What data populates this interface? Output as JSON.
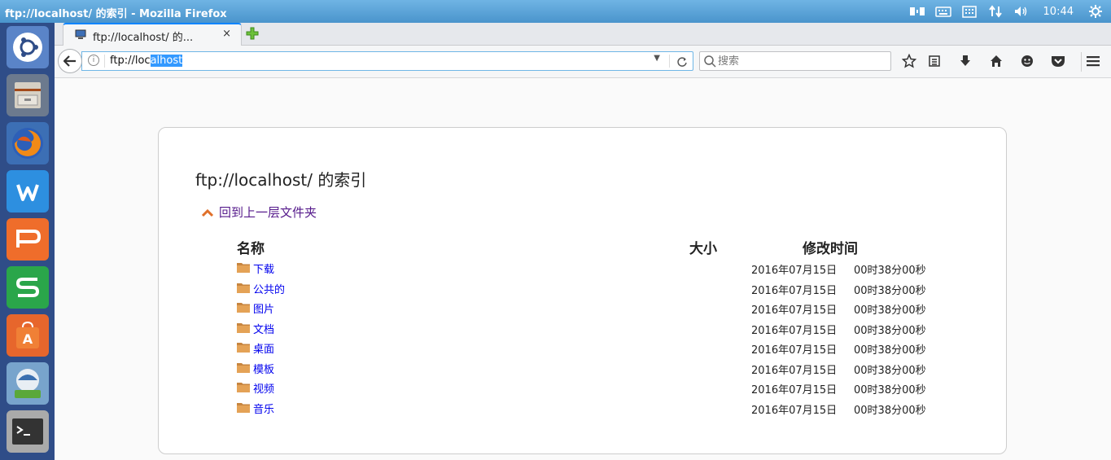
{
  "window": {
    "title": "ftp://localhost/ 的索引 - Mozilla Firefox"
  },
  "tray": {
    "icons": [
      "tiling-icon",
      "keyboard-icon",
      "keyboard-layout-icon",
      "network-icon",
      "volume-icon",
      "settings-gear-icon"
    ],
    "clock": "10:44"
  },
  "launcher": {
    "items": [
      "ubuntu-dash",
      "files",
      "firefox",
      "wps-writer",
      "wps-presentation",
      "wps-spreadsheets",
      "software-center",
      "system-tool",
      "terminal"
    ]
  },
  "tab": {
    "label": "ftp://localhost/ 的...",
    "close": "×"
  },
  "urlbar": {
    "url_plain": "ftp://loc",
    "url_selected": "alhost"
  },
  "search": {
    "placeholder": "搜索"
  },
  "page": {
    "heading": "ftp://localhost/ 的索引",
    "up_link": "回到上一层文件夹",
    "columns": {
      "name": "名称",
      "size": "大小",
      "modified": "修改时间"
    },
    "rows": [
      {
        "name": "下载",
        "date": "2016年07月15日",
        "time": "00时38分00秒"
      },
      {
        "name": "公共的",
        "date": "2016年07月15日",
        "time": "00时38分00秒"
      },
      {
        "name": "图片",
        "date": "2016年07月15日",
        "time": "00时38分00秒"
      },
      {
        "name": "文档",
        "date": "2016年07月15日",
        "time": "00时38分00秒"
      },
      {
        "name": "桌面",
        "date": "2016年07月15日",
        "time": "00时38分00秒"
      },
      {
        "name": "模板",
        "date": "2016年07月15日",
        "time": "00时38分00秒"
      },
      {
        "name": "视频",
        "date": "2016年07月15日",
        "time": "00时38分00秒"
      },
      {
        "name": "音乐",
        "date": "2016年07月15日",
        "time": "00时38分00秒"
      }
    ]
  },
  "colors": {
    "accent": "#0a84ff",
    "link": "#0000ee",
    "visited": "#551a8b",
    "launcher": "#2f4d88"
  }
}
